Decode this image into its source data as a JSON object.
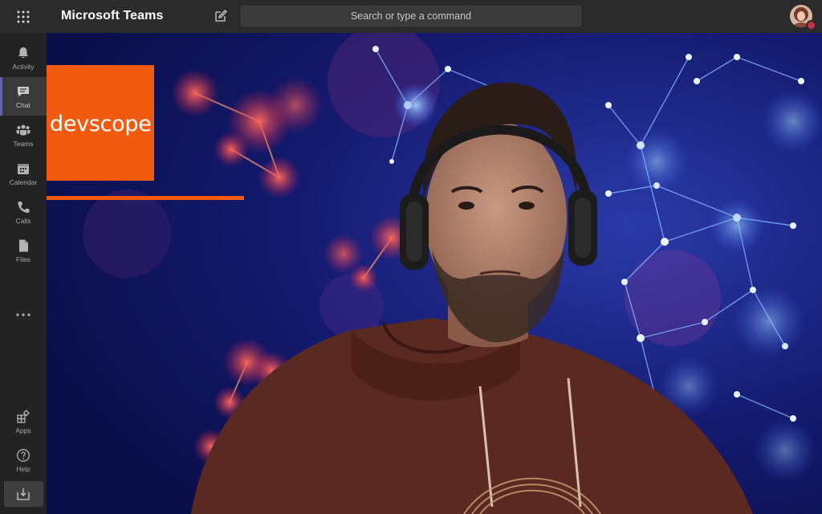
{
  "app": {
    "title": "Microsoft Teams"
  },
  "search": {
    "placeholder": "Search or type a command"
  },
  "rail": {
    "items": [
      {
        "label": "Activity",
        "icon": "bell-icon"
      },
      {
        "label": "Chat",
        "icon": "chat-icon",
        "active": true
      },
      {
        "label": "Teams",
        "icon": "teams-icon"
      },
      {
        "label": "Calendar",
        "icon": "calendar-icon"
      },
      {
        "label": "Calls",
        "icon": "phone-icon"
      },
      {
        "label": "Files",
        "icon": "file-icon"
      }
    ],
    "bottom": [
      {
        "label": "Apps",
        "icon": "apps-icon"
      },
      {
        "label": "Help",
        "icon": "help-icon"
      }
    ]
  },
  "background": {
    "logo_text": "devscope"
  },
  "colors": {
    "brand_orange": "#f15a0f",
    "teams_purple": "#6264a7",
    "presence_busy": "#c4314b",
    "rail_bg": "#232323",
    "topbar_bg": "#2b2b2b"
  }
}
